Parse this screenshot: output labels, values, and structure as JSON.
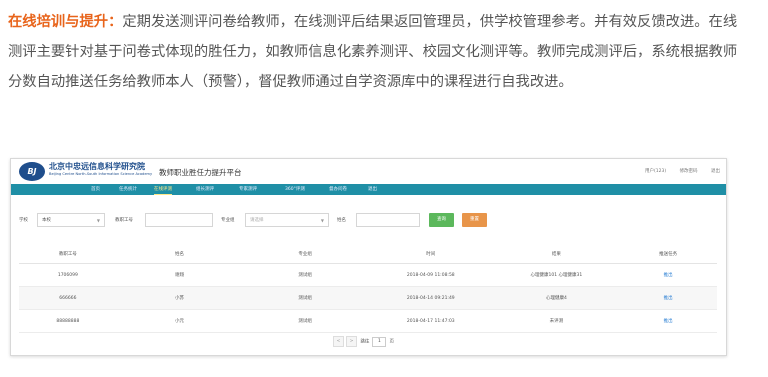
{
  "intro": {
    "highlight": "在线培训与提升：",
    "body": "定期发送测评问卷给教师，在线测评后结果返回管理员，供学校管理参考。并有效反馈改进。在线测评主要针对基于问卷式体现的胜任力，如教师信息化素养测评、校园文化测评等。教师完成测评后，系统根据教师分数自动推送任务给教师本人（预警），督促教师通过自学资源库中的课程进行自我改进。"
  },
  "app": {
    "logo_text": "北京中忠远信息科学研究院",
    "logo_en": "Beijing Centre North-South Information Science Academy",
    "platform_title": "教师职业胜任力提升平台",
    "user": "用户(123)",
    "change_password": "修改密码",
    "logout": "退出"
  },
  "nav": {
    "items": [
      "首页",
      "任务统计",
      "在线评测",
      "组长测评",
      "专家测评",
      "360°评测",
      "督办问卷",
      "退出"
    ],
    "active_index": 2
  },
  "filter": {
    "school_label": "学校",
    "school_value": "本校",
    "teacher_id_label": "教职工号",
    "teacher_id_value": "",
    "group_label": "专业组",
    "group_placeholder": "请选择",
    "name_label": "姓名",
    "name_value": "",
    "query_button": "查询",
    "reset_button": "重置"
  },
  "table": {
    "headers": [
      "教职工号",
      "姓名",
      "专业组",
      "时间",
      "结果",
      "推送任务"
    ],
    "rows": [
      [
        "1706099",
        "谢翔",
        "测试组",
        "2018-04-09 11:08:58",
        "心理健康101 心理健康31",
        "推出"
      ],
      [
        "666666",
        "小苏",
        "测试组",
        "2018-04-14 09:21:49",
        "心理健康4",
        "推出"
      ],
      [
        "88888888",
        "小元",
        "测试组",
        "2018-04-17 11:47:03",
        "未评测",
        "推出"
      ]
    ]
  },
  "pager": {
    "prev": "<",
    "next": ">",
    "go_label": "跳往",
    "page": "1",
    "page_suffix": "页"
  }
}
